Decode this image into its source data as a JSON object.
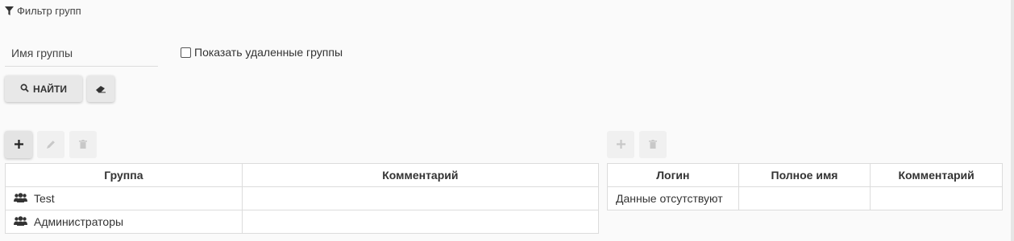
{
  "filter": {
    "title": "Фильтр групп",
    "name_placeholder": "Имя группы",
    "name_value": "",
    "show_deleted_label": "Показать удаленные группы",
    "show_deleted_checked": false,
    "find_label": "НАЙТИ"
  },
  "groups_table": {
    "columns": [
      "Группа",
      "Комментарий"
    ],
    "rows": [
      {
        "name": "Test",
        "comment": ""
      },
      {
        "name": "Администраторы",
        "comment": ""
      }
    ]
  },
  "users_table": {
    "columns": [
      "Логин",
      "Полное имя",
      "Комментарий"
    ],
    "empty_text": "Данные отсутствуют"
  },
  "icons": {
    "filter": "filter-icon",
    "search": "search-icon",
    "eraser": "eraser-icon",
    "add": "plus-icon",
    "edit": "pencil-icon",
    "delete": "trash-icon",
    "group": "users-icon"
  },
  "colors": {
    "background": "#fafafa",
    "button": "#e8e8e8",
    "border": "#dcdcdc",
    "disabled_icon": "#c8c8c8"
  }
}
